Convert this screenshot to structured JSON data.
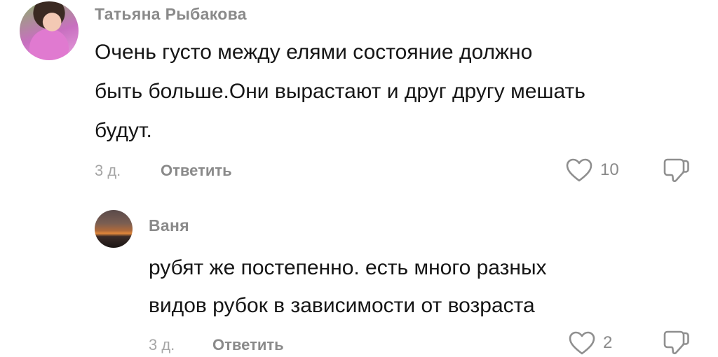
{
  "comments": [
    {
      "author": "Татьяна Рыбакова",
      "text_lines": [
        "Очень густо между елями состояние должно",
        "быть больше.Они вырастают и друг другу мешать",
        "будут."
      ],
      "time": "3 д.",
      "reply_label": "Ответить",
      "likes": "10"
    },
    {
      "author": "Ваня",
      "text_lines": [
        "рубят же постепенно. есть много разных",
        "видов рубок в зависимости от возраста"
      ],
      "time": "3 д.",
      "reply_label": "Ответить",
      "likes": "2"
    }
  ],
  "icons": {
    "like": "heart-icon",
    "dislike": "thumbs-down-icon"
  }
}
